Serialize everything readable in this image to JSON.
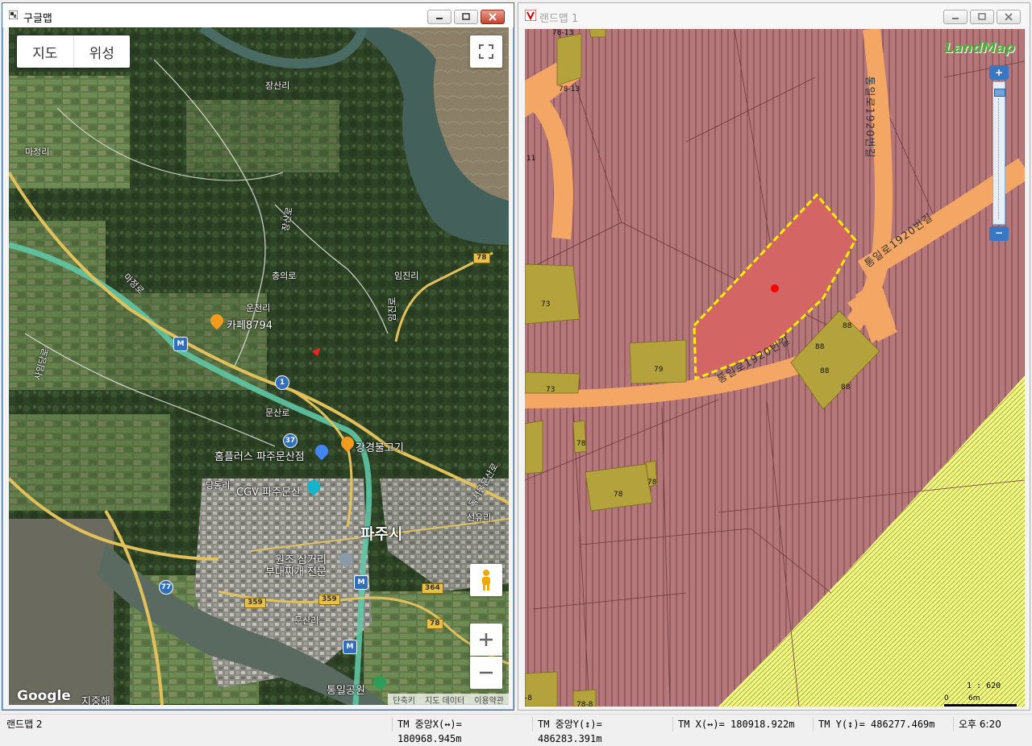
{
  "left_window": {
    "title": "구글맵",
    "map_type": {
      "map": "지도",
      "satellite": "위성"
    },
    "labels": [
      {
        "text": "장산리",
        "name": "label-jangsanri"
      },
      {
        "text": "마정리",
        "name": "label-majeongri"
      },
      {
        "text": "장산로",
        "name": "label-jangsanro"
      },
      {
        "text": "충의로",
        "name": "label-chungui-ro"
      },
      {
        "text": "임진리",
        "name": "label-imjinri"
      },
      {
        "text": "운천리",
        "name": "label-uncheonri"
      },
      {
        "text": "카페8794",
        "name": "label-cafe8794"
      },
      {
        "text": "문산로",
        "name": "label-munsan-ro"
      },
      {
        "text": "강경불고기",
        "name": "label-gangyeong-bulgogi"
      },
      {
        "text": "홈플러스 파주문산점",
        "name": "label-homeplus"
      },
      {
        "text": "당동리",
        "name": "label-dangdongri"
      },
      {
        "text": "CGV 파주문산",
        "name": "label-cgv"
      },
      {
        "text": "파주시",
        "name": "label-pajusi"
      },
      {
        "text": "원조 삼거리",
        "name": "label-wonjo-samgeori"
      },
      {
        "text": "부대찌개 전문",
        "name": "label-budae-jjigae"
      },
      {
        "text": "선유리",
        "name": "label-seonyuri"
      },
      {
        "text": "문산리",
        "name": "label-munsanri"
      },
      {
        "text": "통일공원",
        "name": "label-tongil-park"
      },
      {
        "text": "지중해",
        "name": "label-jijunghae"
      },
      {
        "text": "임진로",
        "name": "label-imjin-ro"
      },
      {
        "text": "사임당로",
        "name": "label-saimdang-ro"
      },
      {
        "text": "독서울문산로",
        "name": "label-dokseoul-munsan-ro"
      },
      {
        "text": "마정로",
        "name": "label-majeong-ro"
      }
    ],
    "route_shields": {
      "r78a": "78",
      "r1": "1",
      "r37": "37",
      "r77": "77",
      "r359a": "359",
      "r359b": "359",
      "r364": "364",
      "r78b": "78",
      "m1": "M",
      "m2": "M",
      "m3": "M"
    },
    "logo": "Google",
    "footer": [
      "단축키",
      "지도 데이터",
      "이용약관"
    ]
  },
  "right_window": {
    "title": "랜드맵 1",
    "logo": "LandMap",
    "parcels": [
      {
        "text": "78-13",
        "name": "parcel-78-13-top"
      },
      {
        "text": "78-13",
        "name": "parcel-78-13"
      },
      {
        "text": "11",
        "name": "parcel-11"
      },
      {
        "text": "73",
        "name": "parcel-73-a"
      },
      {
        "text": "79",
        "name": "parcel-79"
      },
      {
        "text": "73",
        "name": "parcel-73-b"
      },
      {
        "text": "88",
        "name": "parcel-88-a"
      },
      {
        "text": "88",
        "name": "parcel-88-b"
      },
      {
        "text": "88",
        "name": "parcel-88-c"
      },
      {
        "text": "88",
        "name": "parcel-88-d"
      },
      {
        "text": "78",
        "name": "parcel-78-a"
      },
      {
        "text": "78",
        "name": "parcel-78-b"
      },
      {
        "text": "78",
        "name": "parcel-78-c"
      },
      {
        "text": "-8",
        "name": "parcel-minus8"
      },
      {
        "text": "78-8",
        "name": "parcel-78-8"
      }
    ],
    "road_labels": {
      "vertical": "통일로1920번길",
      "diagonal": "통일로1920번길",
      "lower": "통일로1920번길"
    },
    "scale": {
      "ratio": "1 : 620",
      "zero": "0",
      "unit": "6m"
    }
  },
  "status_bar": {
    "app": "랜드맵 2",
    "tm_center_x": "TM 중앙X(↔)= 180968.945m",
    "tm_center_y": "TM 중앙Y(↕)= 486283.391m",
    "tm_x": "TM X(↔)= 180918.922m",
    "tm_y": "TM Y(↕)= 486277.469m",
    "time": "오후 6:20"
  },
  "colors": {
    "zone_brown": "#b5787a",
    "parcel_olive": "#b4a23c",
    "road_orange": "#f4a765",
    "selected_red": "#d46565",
    "yellow_zone": "#f2f77e",
    "selection_dash": "#ffef00"
  }
}
